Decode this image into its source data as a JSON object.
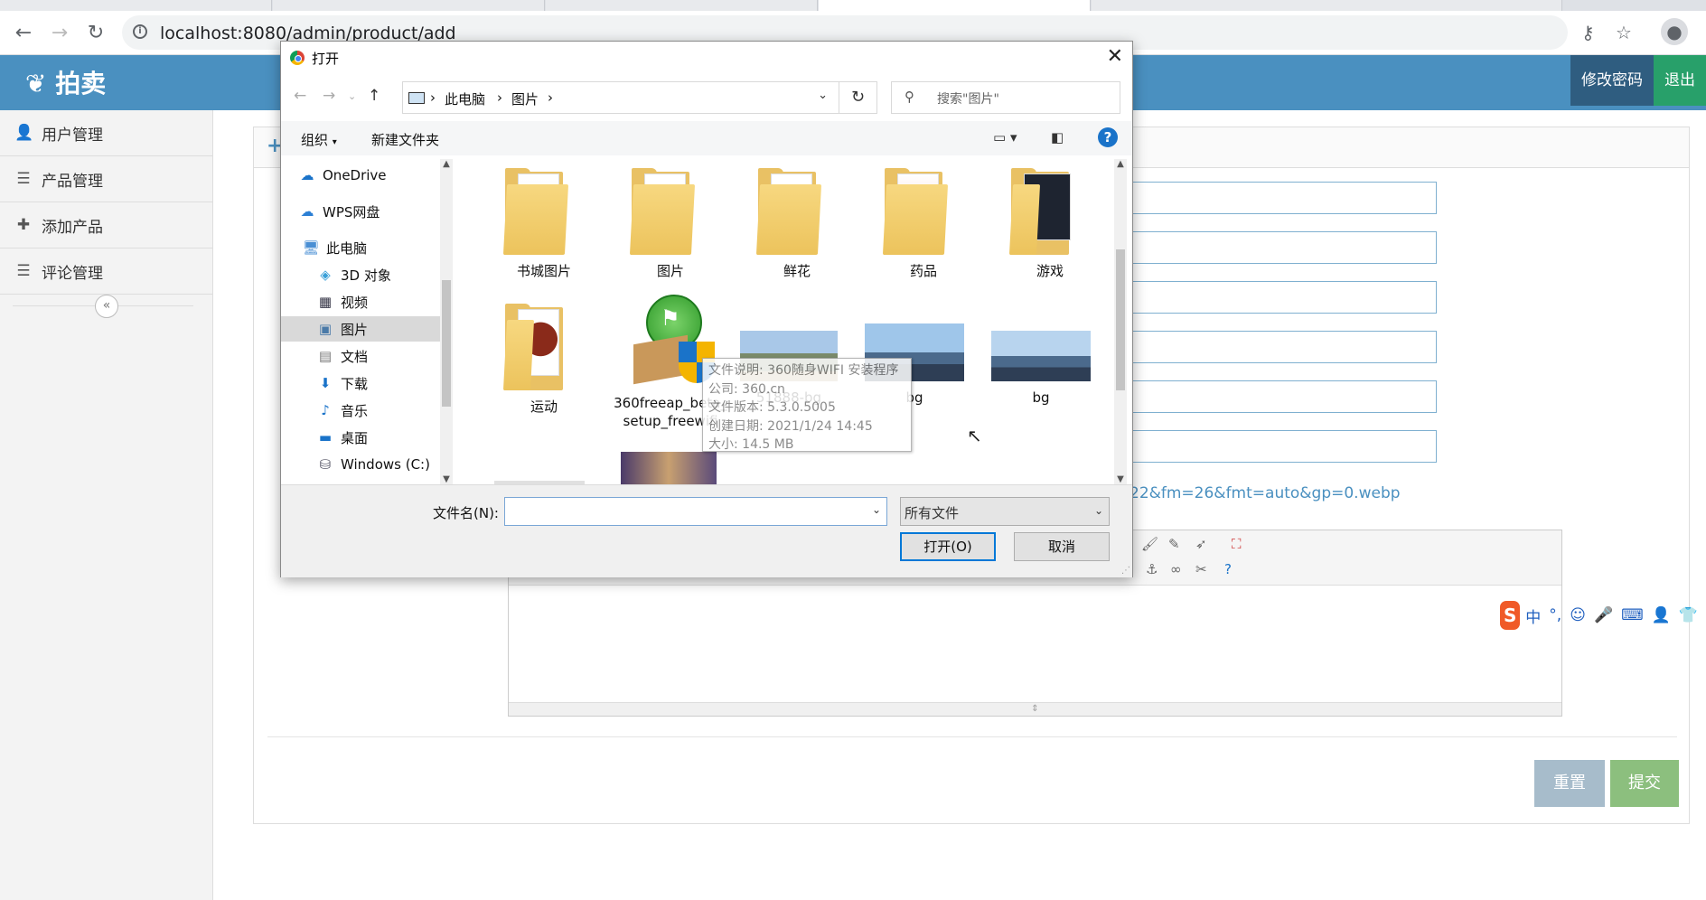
{
  "browser": {
    "url": "localhost:8080/admin/product/add"
  },
  "app": {
    "brand": "拍卖",
    "change_password": "修改密码",
    "logout": "退出"
  },
  "sidebar": {
    "items": [
      {
        "label": "用户管理",
        "icon": "user-icon"
      },
      {
        "label": "产品管理",
        "icon": "list-icon"
      },
      {
        "label": "添加产品",
        "icon": "plus-icon"
      },
      {
        "label": "评论管理",
        "icon": "list-icon"
      }
    ]
  },
  "form": {
    "image_url_tail": "22&fm=26&fmt=auto&gp=0.webp",
    "reset": "重置",
    "submit": "提交"
  },
  "ime": {
    "items": [
      "中",
      "°,"
    ]
  },
  "dialog": {
    "title": "打开",
    "breadcrumb": [
      "此电脑",
      "图片"
    ],
    "search_placeholder": "搜索\"图片\"",
    "organize": "组织",
    "new_folder": "新建文件夹",
    "nav": [
      {
        "label": "OneDrive",
        "icon": "cloud-icon"
      },
      {
        "label": "WPS网盘",
        "icon": "cloud-icon"
      },
      {
        "label": "此电脑",
        "icon": "computer-icon"
      },
      {
        "label": "3D 对象",
        "icon": "cube-icon"
      },
      {
        "label": "视频",
        "icon": "video-icon"
      },
      {
        "label": "图片",
        "icon": "picture-icon",
        "selected": true
      },
      {
        "label": "文档",
        "icon": "document-icon"
      },
      {
        "label": "下载",
        "icon": "download-icon"
      },
      {
        "label": "音乐",
        "icon": "music-icon"
      },
      {
        "label": "桌面",
        "icon": "desktop-icon"
      },
      {
        "label": "Windows (C:)",
        "icon": "drive-icon"
      }
    ],
    "files": [
      {
        "label": "书城图片",
        "kind": "folder"
      },
      {
        "label": "图片",
        "kind": "folder"
      },
      {
        "label": "鲜花",
        "kind": "folder"
      },
      {
        "label": "药品",
        "kind": "folder"
      },
      {
        "label": "游戏",
        "kind": "folder"
      },
      {
        "label": "运动",
        "kind": "folder"
      },
      {
        "label": "360freeap_beta_setup_freewifi",
        "kind": "installer"
      },
      {
        "label": "51888-bg",
        "kind": "image"
      },
      {
        "label": "bg",
        "kind": "image"
      },
      {
        "label": "bg",
        "kind": "image"
      }
    ],
    "tooltip": [
      "文件说明: 360随身WIFI 安装程序",
      "公司: 360.cn",
      "文件版本: 5.3.0.5005",
      "创建日期: 2021/1/24 14:45",
      "大小: 14.5 MB"
    ],
    "filename_label": "文件名(N):",
    "filename_value": "",
    "filter": "所有文件",
    "open": "打开(O)",
    "cancel": "取消"
  }
}
